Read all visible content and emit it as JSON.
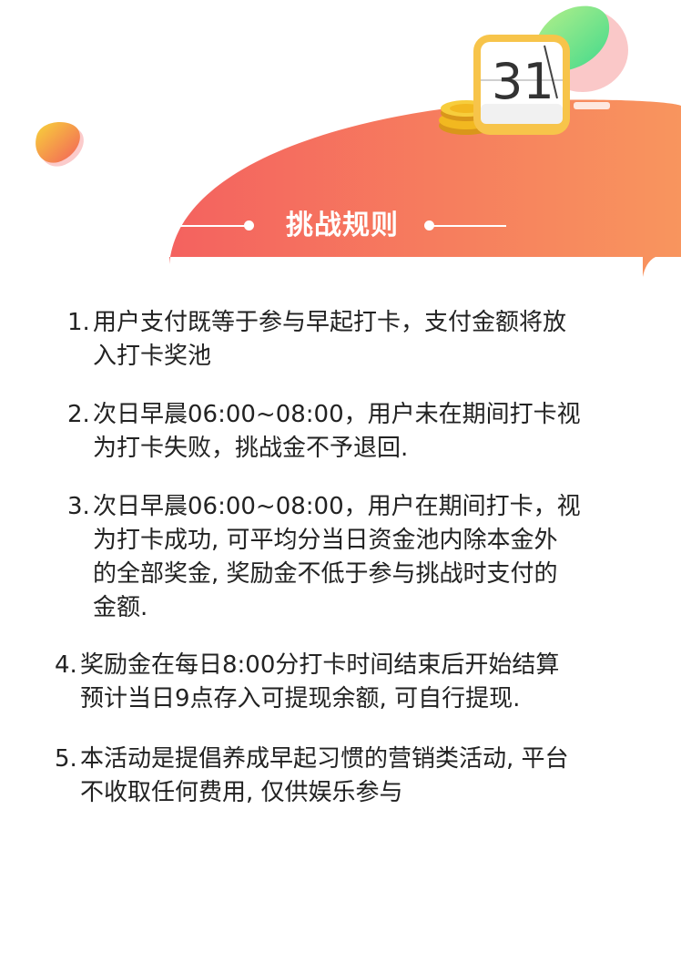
{
  "header": {
    "calendar_icon_text": "31",
    "title": "挑战规则"
  },
  "rules": [
    {
      "number": "1.",
      "lines": [
        "用户支付既等于参与早起打卡，支付金额将放",
        "入打卡奖池"
      ]
    },
    {
      "number": "2.",
      "lines": [
        "次日早晨06:00~08:00，用户未在期间打卡视",
        "为打卡失败，挑战金不予退回."
      ]
    },
    {
      "number": "3.",
      "lines": [
        "次日早晨06:00~08:00，用户在期间打卡，视",
        "为打卡成功, 可平均分当日资金池内除本金外",
        "的全部奖金, 奖励金不低于参与挑战时支付的",
        "金额."
      ]
    },
    {
      "number": "4.",
      "lines": [
        "奖励金在每日8:00分打卡时间结束后开始结算",
        "预计当日9点存入可提现余额, 可自行提现."
      ]
    },
    {
      "number": "5.",
      "lines": [
        "本活动是提倡养成早起习惯的营销类活动, 平台",
        "不收取任何费用, 仅供娱乐参与"
      ]
    }
  ],
  "colors": {
    "banner_start": "#f4625f",
    "banner_end": "#f8945e",
    "green_leaf": "#5fe08a",
    "yellow_blob": "#f7c23a",
    "coin": "#f2b820",
    "calendar_frame": "#f7c44a"
  }
}
